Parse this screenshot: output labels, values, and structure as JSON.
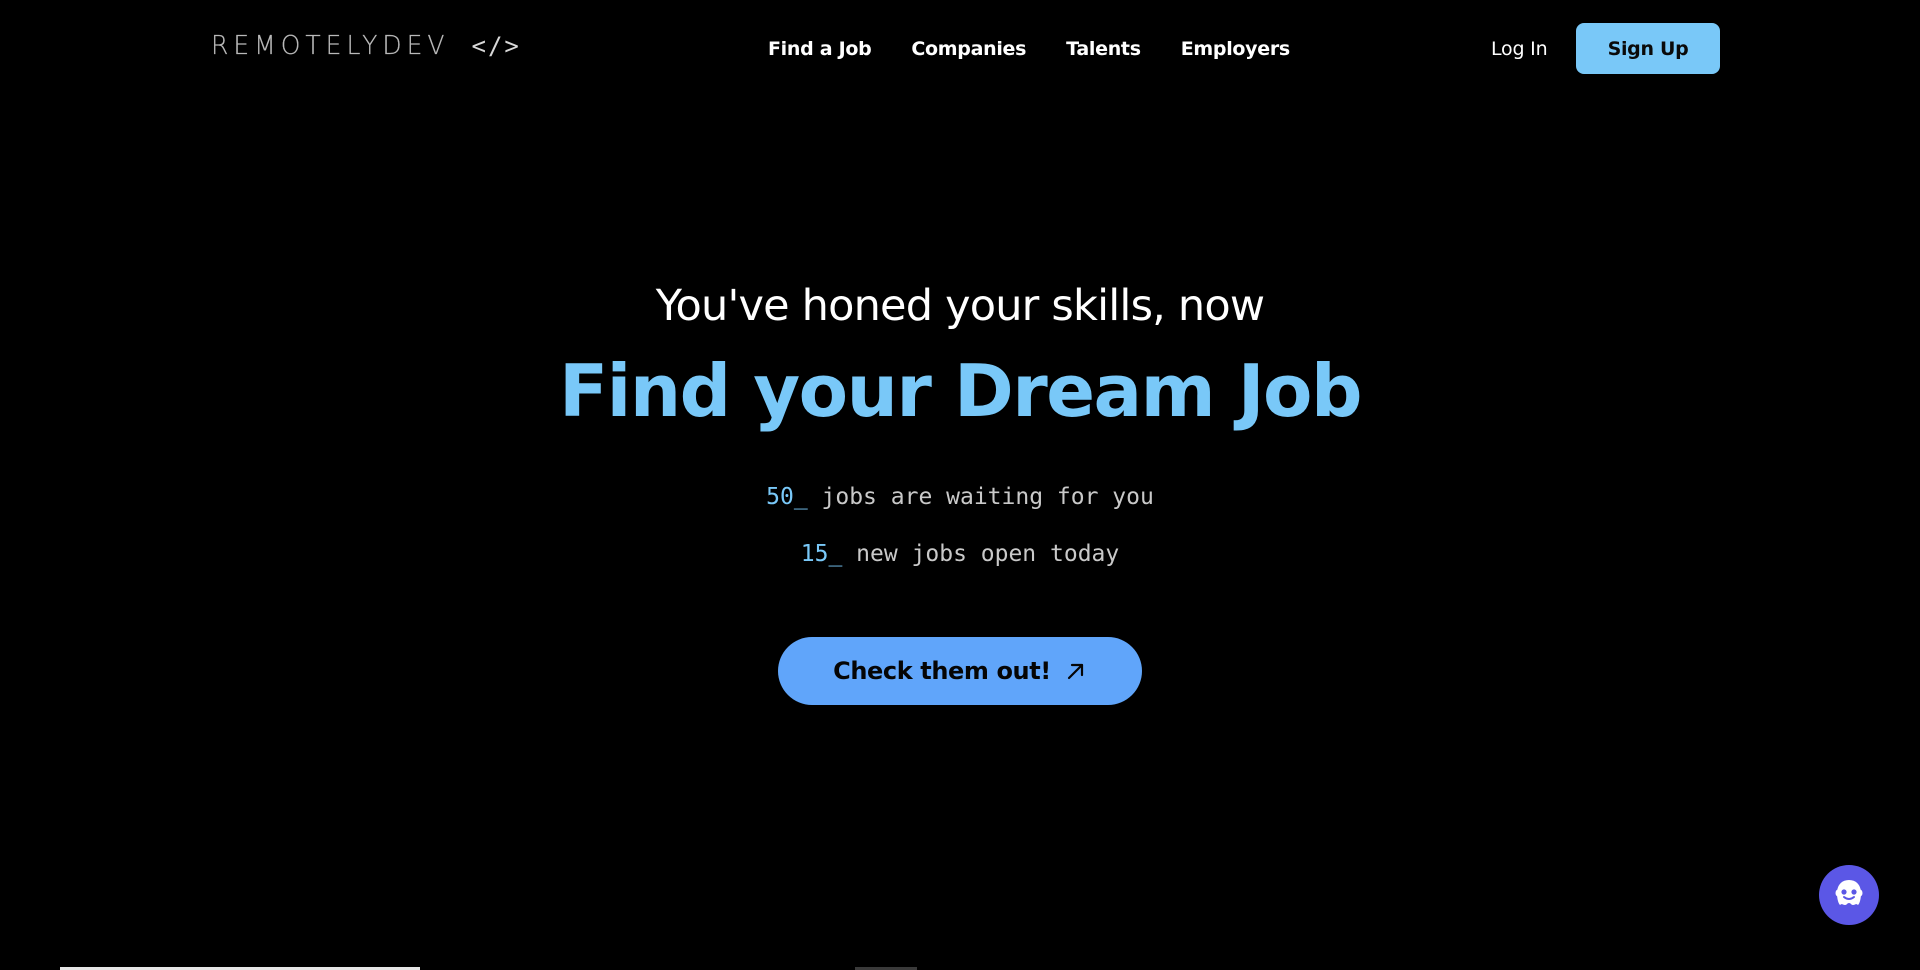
{
  "header": {
    "logo_text": "REMOTELYDEV",
    "logo_code": "</>",
    "nav": [
      {
        "label": "Find a Job"
      },
      {
        "label": "Companies"
      },
      {
        "label": "Talents"
      },
      {
        "label": "Employers"
      }
    ],
    "login_label": "Log In",
    "signup_label": "Sign Up"
  },
  "hero": {
    "subtitle": "You've honed your skills, now",
    "title": "Find your Dream Job",
    "stats": [
      {
        "number": "50_",
        "text": " jobs are waiting for you"
      },
      {
        "number": "15_",
        "text": " new jobs open today"
      }
    ],
    "cta_label": "Check them out!",
    "cta_icon": "arrow-up-right-icon"
  },
  "chat_widget": {
    "icon": "chat-bot-icon"
  },
  "colors": {
    "background": "#000000",
    "accent": "#79c8f8",
    "cta": "#60a5fa",
    "chat": "#5b57e6"
  }
}
